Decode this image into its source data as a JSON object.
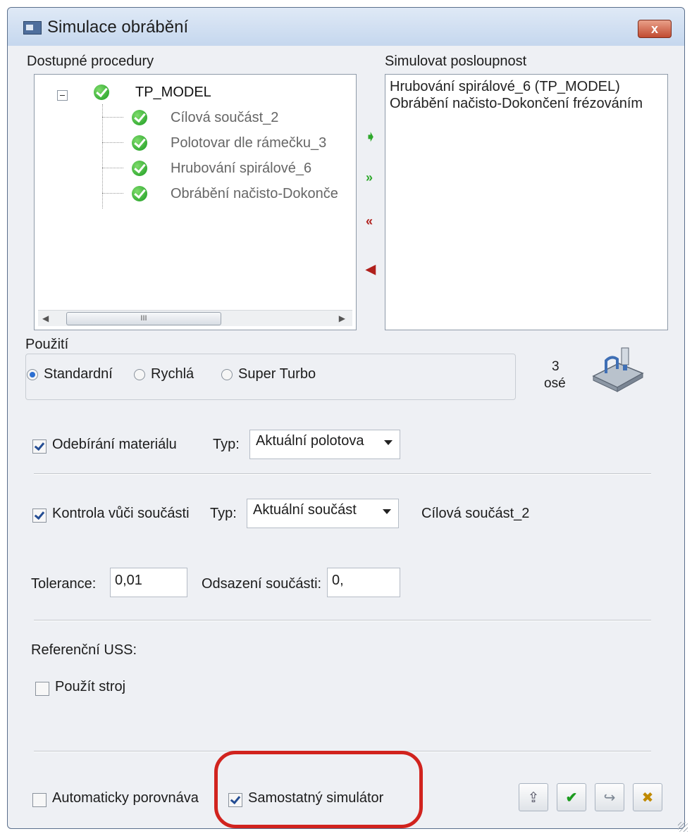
{
  "window": {
    "title": "Simulace obrábění",
    "close_label": "x"
  },
  "available": {
    "label": "Dostupné procedury",
    "root": "TP_MODEL",
    "items": [
      "Cílová součást_2",
      "Polotovar dle rámečku_3",
      "Hrubování spirálové_6",
      "Obrábění načisto-Dokonče"
    ],
    "scroll_thumb": "III"
  },
  "sequence": {
    "label": "Simulovat posloupnost",
    "items": [
      "Hrubování spirálové_6 (TP_MODEL)",
      "Obrábění načisto-Dokončení frézováním"
    ]
  },
  "usage": {
    "label": "Použití",
    "options": [
      "Standardní",
      "Rychlá",
      "Super Turbo"
    ],
    "selected": "Standardní",
    "axes_number": "3",
    "axes_unit": "osé"
  },
  "material": {
    "checkbox_label": "Odebírání materiálu",
    "checked": true,
    "type_label": "Typ:",
    "type_value": "Aktuální polotova"
  },
  "check": {
    "checkbox_label": "Kontrola vůči součásti",
    "checked": true,
    "type_label": "Typ:",
    "type_value": "Aktuální součást",
    "target": "Cílová součást_2"
  },
  "tolerance": {
    "label": "Tolerance:",
    "value": "0,01",
    "offset_label": "Odsazení součásti:",
    "offset_value": "0,"
  },
  "reference": {
    "label": "Referenční USS:",
    "machine_label": "Použít stroj",
    "machine_checked": false
  },
  "footer": {
    "auto_label": "Automaticky porovnáva",
    "auto_checked": false,
    "standalone_label": "Samostatný simulátor",
    "standalone_checked": true
  },
  "colors": {
    "highlight": "#d1231e",
    "arrow_green": "#2ea82b",
    "arrow_red": "#b0201c"
  }
}
